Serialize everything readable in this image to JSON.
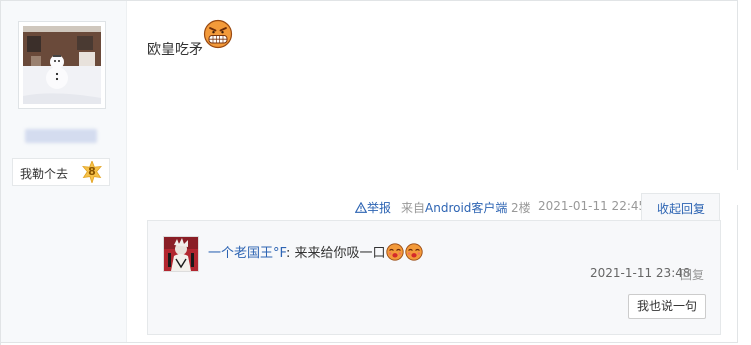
{
  "author": {
    "level_name": "我勒个去",
    "level": "8"
  },
  "post": {
    "content": "欧皇吃矛",
    "emoji": "grinning-angry-face"
  },
  "tail": {
    "report": "举报",
    "from_prefix": "来自",
    "from_client": "Android客户端",
    "floor": "2楼",
    "time": "2021-01-11 22:45",
    "collapse": "收起回复"
  },
  "reply": {
    "user": "一个老国王°F",
    "content": ": 来来给你吸一口",
    "emoji": "kiss-face",
    "time": "2021-1-11 23:48",
    "reply_label": "回复",
    "say_button": "我也说一句"
  },
  "colors": {
    "link": "#2d64b3",
    "sidebar_bg": "#f7f9fb",
    "reply_bg": "#f7f8fa"
  }
}
